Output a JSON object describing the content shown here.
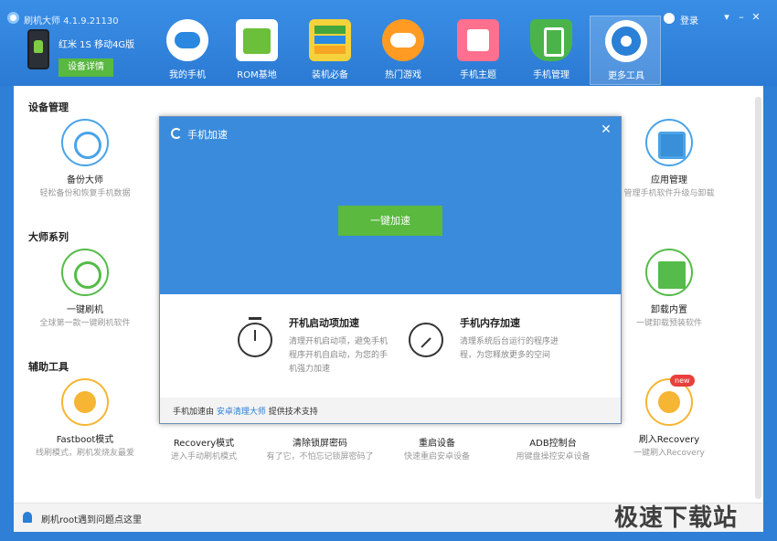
{
  "app": {
    "title": "刷机大师 4.1.9.21130",
    "device_name": "红米 1S 移动4G版",
    "device_detail_btn": "设备详情",
    "login": "登录"
  },
  "nav": [
    {
      "label": "我的手机"
    },
    {
      "label": "ROM基地"
    },
    {
      "label": "装机必备"
    },
    {
      "label": "热门游戏"
    },
    {
      "label": "手机主题"
    },
    {
      "label": "手机管理"
    },
    {
      "label": "更多工具"
    }
  ],
  "sections": {
    "device": "设备管理",
    "master": "大师系列",
    "assist": "辅助工具"
  },
  "tools": {
    "backup": {
      "name": "备份大师",
      "desc": "轻松备份和恢复手机数据"
    },
    "app_manage": {
      "name": "应用管理",
      "desc": "管理手机软件升级与卸载"
    },
    "one_flash": {
      "name": "一键刷机",
      "desc": "全球第一款一键刷机软件"
    },
    "uninstall": {
      "name": "卸载内置",
      "desc": "一键卸载预装软件"
    },
    "fastboot": {
      "name": "Fastboot模式",
      "desc": "线刷模式，刷机发烧友最爱"
    },
    "recovery_mode": {
      "name": "Recovery模式",
      "desc": "进入手动刷机模式"
    },
    "clear_lock": {
      "name": "清除锁屏密码",
      "desc": "有了它，不怕忘记锁屏密码了"
    },
    "reboot": {
      "name": "重启设备",
      "desc": "快速重启安卓设备"
    },
    "adb": {
      "name": "ADB控制台",
      "desc": "用键盘操控安卓设备"
    },
    "flash_recovery": {
      "name": "刷入Recovery",
      "desc": "一键刷入Recovery",
      "badge": "new"
    }
  },
  "bottom": {
    "text": "刷机root遇到问题点这里"
  },
  "watermark": "极速下载站",
  "modal": {
    "title": "手机加速",
    "close": "✕",
    "button": "一键加速",
    "features": [
      {
        "title": "开机启动项加速",
        "desc": "清理开机启动项，避免手机程序开机自启动，为您的手机强力加速"
      },
      {
        "title": "手机内存加速",
        "desc": "清理系统后台运行的程序进程，为您释放更多的空间"
      }
    ],
    "footer_prefix": "手机加速由 ",
    "footer_link": "安卓清理大师",
    "footer_suffix": " 提供技术支持"
  }
}
